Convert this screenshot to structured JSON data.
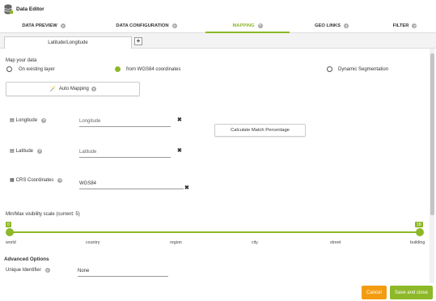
{
  "app": {
    "title": "Data Editor",
    "icon": "database-icon"
  },
  "nav": {
    "tabs": [
      {
        "label": "DATA PREVIEW"
      },
      {
        "label": "DATA CONFIGURATION"
      },
      {
        "label": "MAPPING"
      },
      {
        "label": "GEO LINKS"
      },
      {
        "label": "FILTER"
      }
    ],
    "active": "MAPPING"
  },
  "subtabs": {
    "active_label": "Latitude/Longitude",
    "add_label": "+"
  },
  "map_data": {
    "heading": "Map your data",
    "options": [
      {
        "label": "On existing layer",
        "selected": false
      },
      {
        "label": "from WGS84 coordinates",
        "selected": true
      },
      {
        "label": "Dynamic Segmentation",
        "selected": false
      }
    ]
  },
  "auto_mapping": {
    "label": "Auto Mapping"
  },
  "fields": {
    "longitude": {
      "label": "Longitude",
      "placeholder": "Longitude",
      "value": ""
    },
    "latitude": {
      "label": "Latitude",
      "placeholder": "Latitude",
      "value": ""
    },
    "crs": {
      "label": "CRS Coordinates",
      "value": "WGS84"
    },
    "clear_symbol": "✖"
  },
  "calc_button": {
    "label": "Calculate Match Percentage"
  },
  "visibility": {
    "label": "Min/Max visibility scale (current: 5)",
    "min": 0,
    "max": 18,
    "min_label": "0",
    "max_label": "18",
    "ticks": [
      "world",
      "country",
      "region",
      "city",
      "street",
      "building"
    ]
  },
  "advanced": {
    "title": "Advanced Options",
    "unique_identifier": {
      "label": "Unique Identifier",
      "value": "None"
    }
  },
  "footer": {
    "cancel_label": "Cancel",
    "save_label": "Save and close"
  },
  "colors": {
    "accent": "#8db828",
    "cancel": "#f39c12"
  }
}
